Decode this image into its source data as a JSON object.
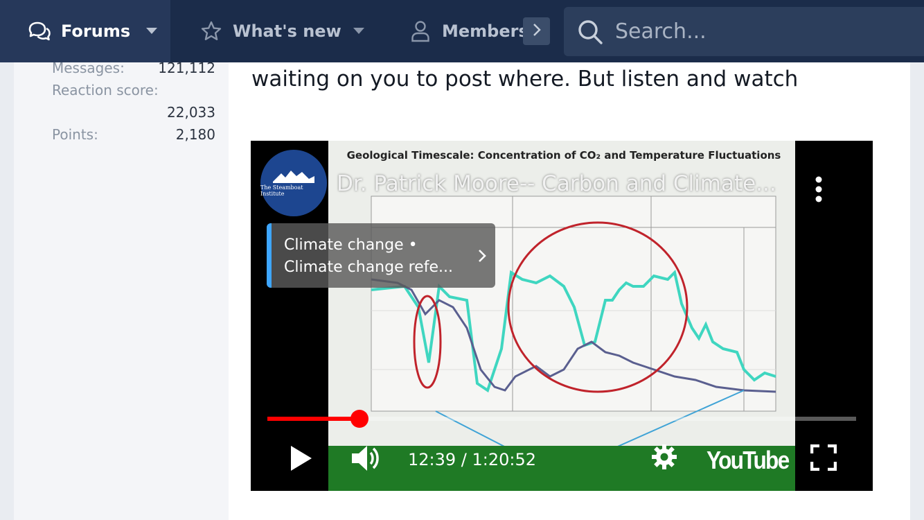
{
  "nav": {
    "items": [
      {
        "label": "Forums",
        "icon": "chat-bubbles-icon"
      },
      {
        "label": "What's new",
        "icon": "star-icon"
      },
      {
        "label": "Members",
        "icon": "user-icon"
      }
    ],
    "more_icon": "chevron-right-icon",
    "search_placeholder": "Search..."
  },
  "user_stats": {
    "messages_label": "Messages:",
    "messages_value": "121,112",
    "reaction_label": "Reaction score:",
    "reaction_value": "22,033",
    "points_label": "Points:",
    "points_value": "2,180"
  },
  "post": {
    "text": "waiting on you to post where. But listen and watch"
  },
  "video": {
    "title": "Dr. Patrick Moore-- Carbon and Climate...",
    "channel_name": "The Steamboat Institute",
    "frame_heading": "Geological Timescale: Concentration of CO₂ and Temperature Fluctuations",
    "card_line1": "Climate change •",
    "card_line2": "Climate change refe...",
    "current_time": "12:39",
    "duration": "1:20:52",
    "time_display": "12:39 / 1:20:52",
    "progress_fraction": 0.156,
    "brand": "YouTube",
    "accent_color": "#ff0000",
    "card_accent_color": "#3ea6ff"
  },
  "colors": {
    "nav_bg": "#1b2c4a",
    "nav_active_bg": "#26385a"
  }
}
